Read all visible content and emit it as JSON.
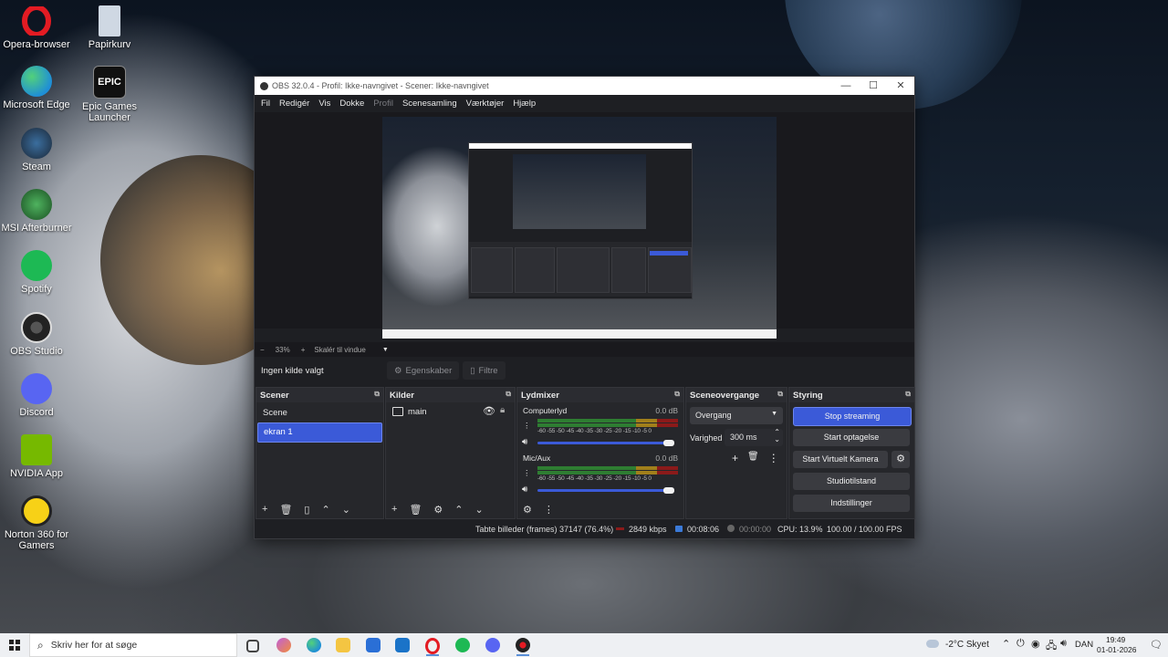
{
  "desktop": {
    "icons": [
      {
        "label": "Opera-browser",
        "icon": "opera-icon",
        "color": "#e31b23"
      },
      {
        "label": "Papirkurv",
        "icon": "recycle-bin-icon",
        "color": "#cfd8e3"
      },
      {
        "label": "Microsoft Edge",
        "icon": "edge-icon",
        "color": "#1f8fd6"
      },
      {
        "label": "Epic Games Launcher",
        "icon": "epic-games-icon",
        "color": "#111111"
      },
      {
        "label": "Steam",
        "icon": "steam-icon",
        "color": "#1b2838"
      },
      {
        "label": "MSI Afterburner",
        "icon": "msi-afterburner-icon",
        "color": "#2e8b3e"
      },
      {
        "label": "Spotify",
        "icon": "spotify-icon",
        "color": "#1db954"
      },
      {
        "label": "OBS Studio",
        "icon": "obs-icon",
        "color": "#222222"
      },
      {
        "label": "Discord",
        "icon": "discord-icon",
        "color": "#5865f2"
      },
      {
        "label": "NVIDIA App",
        "icon": "nvidia-icon",
        "color": "#76b900"
      },
      {
        "label": "Norton 360 for Gamers",
        "icon": "norton-icon",
        "color": "#f7d117"
      }
    ],
    "epic_text": "EPIC"
  },
  "window": {
    "title": "OBS 32.0.4 - Profil: Ikke-navngivet - Scener: Ikke-navngivet",
    "minimize": "—",
    "maximize": "☐",
    "close": "✕"
  },
  "menu": [
    "Fil",
    "Redigér",
    "Vis",
    "Dokke",
    "Profil",
    "Scenesamling",
    "Værktøjer",
    "Hjælp"
  ],
  "zoom": {
    "minus": "−",
    "value": "33%",
    "plus": "+",
    "mode": "Skalér til vindue",
    "chevron": "▼"
  },
  "source_bar": {
    "no_source": "Ingen kilde valgt",
    "properties": "Egenskaber",
    "filters": "Filtre"
  },
  "scenes": {
    "title": "Scener",
    "items": [
      "Scene",
      "ekran 1"
    ],
    "selected": "ekran 1"
  },
  "sources": {
    "title": "Kilder",
    "items": [
      "main"
    ]
  },
  "mixer": {
    "title": "Lydmixer",
    "tracks": [
      {
        "name": "Computerlyd",
        "db": "0.0 dB",
        "level": 0.97,
        "volume": 1.0
      },
      {
        "name": "Mic/Aux",
        "db": "0.0 dB",
        "level": 0.97,
        "volume": 1.0
      }
    ],
    "ticks": "-60 -55 -50 -45 -40 -35 -30 -25 -20 -15 -10  -5   0"
  },
  "transitions": {
    "title": "Sceneovergange",
    "selected": "Overgang",
    "duration_label": "Varighed",
    "duration_value": "300 ms"
  },
  "controls": {
    "title": "Styring",
    "stop_streaming": "Stop streaming",
    "start_recording": "Start optagelse",
    "virtual_camera": "Start Virtuelt Kamera",
    "studio_mode": "Studiotilstand",
    "settings": "Indstillinger"
  },
  "status": {
    "dropped": "Tabte billeder (frames) 37147 (76.4%)",
    "bitrate": "2849 kbps",
    "stream_time": "00:08:06",
    "rec_time": "00:00:00",
    "cpu": "CPU: 13.9%",
    "fps": "100.00 / 100.00 FPS"
  },
  "taskbar": {
    "search_placeholder": "Skriv her for at søge",
    "weather": "-2°C  Skyet",
    "lang": "DAN",
    "time": "19:49",
    "date": "01-01-2026",
    "apps": [
      {
        "icon": "task-view-icon",
        "color": "#444444"
      },
      {
        "icon": "copilot-icon",
        "color": "#c05fd8"
      },
      {
        "icon": "edge-icon",
        "color": "#1f8fd6"
      },
      {
        "icon": "file-explorer-icon",
        "color": "#f4c542"
      },
      {
        "icon": "microsoft-store-icon",
        "color": "#2a6fd6"
      },
      {
        "icon": "outlook-icon",
        "color": "#1a73c8"
      },
      {
        "icon": "opera-icon",
        "color": "#e31b23"
      },
      {
        "icon": "spotify-icon",
        "color": "#1db954"
      },
      {
        "icon": "discord-icon",
        "color": "#5865f2"
      },
      {
        "icon": "obs-icon",
        "color": "#222222"
      }
    ]
  }
}
